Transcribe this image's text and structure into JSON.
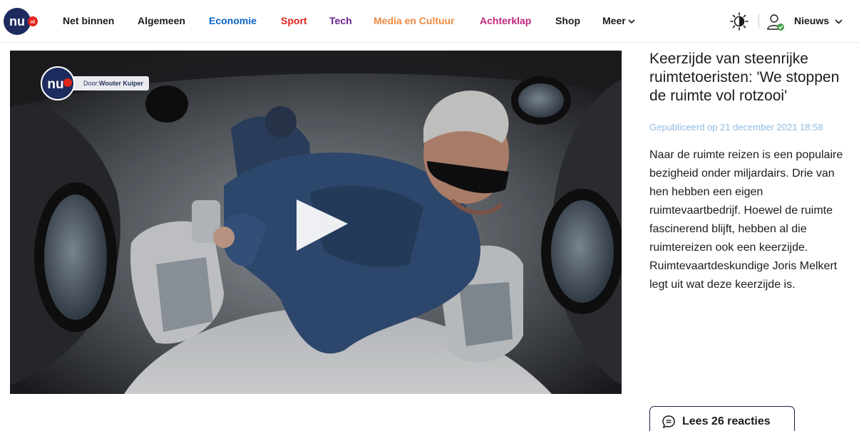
{
  "brand": {
    "logo_text": "nu",
    "logo_suffix": "nl",
    "logo_color": "#1d2b5e",
    "accent_color": "#e2231a"
  },
  "nav": {
    "items": [
      {
        "label": "Net binnen",
        "color": "#1b1b1b"
      },
      {
        "label": "Algemeen",
        "color": "#1b1b1b"
      },
      {
        "label": "Economie",
        "color": "#0a64c8"
      },
      {
        "label": "Sport",
        "color": "#e2231a"
      },
      {
        "label": "Tech",
        "color": "#6c1f8c"
      },
      {
        "label": "Media en Cultuur",
        "color": "#ef8a43"
      },
      {
        "label": "Achterklap",
        "color": "#c3247c"
      },
      {
        "label": "Shop",
        "color": "#1b1b1b"
      },
      {
        "label": "Meer",
        "color": "#1b1b1b"
      }
    ],
    "theme_icon": "sun-moon-icon",
    "user_icon": "user-icon",
    "section_label": "Nieuws",
    "user_status_color": "#43a047"
  },
  "video": {
    "badge_prefix": "Door:",
    "badge_author": "Wouter Kuiper",
    "play_icon": "play-icon"
  },
  "article": {
    "headline": "Keerzijde van steenrijke ruimtetoeristen: 'We stoppen de ruimte vol rotzooi'",
    "published": "Gepubliceerd op 21 december 2021 18:58",
    "summary": "Naar de ruimte reizen is een populaire bezigheid onder miljardairs. Drie van hen hebben een eigen ruimtevaartbedrijf. Hoewel de ruimte fascinerend blijft, hebben al die ruimtereizen ook een keerzijde. Ruimtevaartdeskundige Joris Melkert legt uit wat deze keerzijde is.",
    "comments_label": "Lees 26 reacties",
    "comments_icon": "comment-icon"
  }
}
